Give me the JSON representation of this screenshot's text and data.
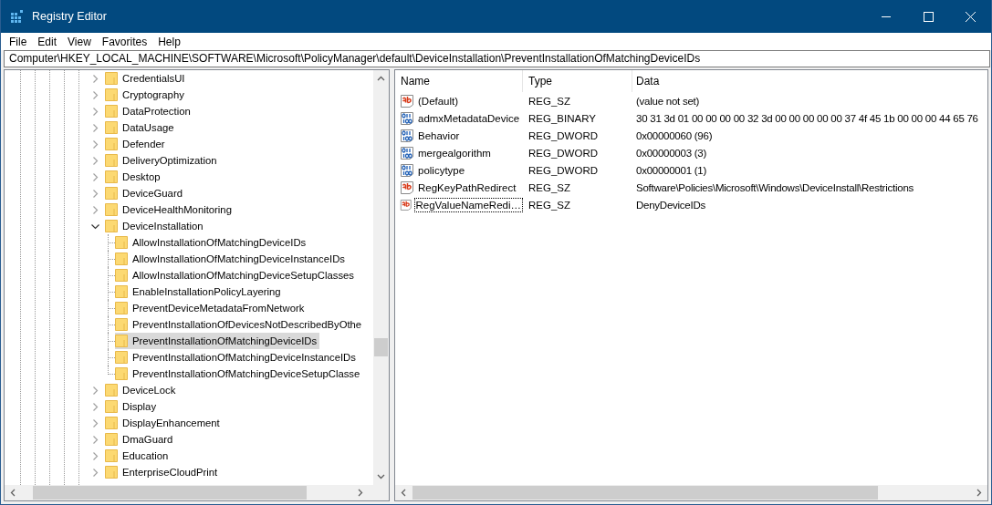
{
  "window": {
    "title": "Registry Editor"
  },
  "menu": [
    "File",
    "Edit",
    "View",
    "Favorites",
    "Help"
  ],
  "address": "Computer\\HKEY_LOCAL_MACHINE\\SOFTWARE\\Microsoft\\PolicyManager\\default\\DeviceInstallation\\PreventInstallationOfMatchingDeviceIDs",
  "tree": [
    {
      "label": "CredentialsUI",
      "expanded": false,
      "selected": false
    },
    {
      "label": "Cryptography",
      "expanded": false,
      "selected": false
    },
    {
      "label": "DataProtection",
      "expanded": false,
      "selected": false
    },
    {
      "label": "DataUsage",
      "expanded": false,
      "selected": false
    },
    {
      "label": "Defender",
      "expanded": false,
      "selected": false
    },
    {
      "label": "DeliveryOptimization",
      "expanded": false,
      "selected": false
    },
    {
      "label": "Desktop",
      "expanded": false,
      "selected": false
    },
    {
      "label": "DeviceGuard",
      "expanded": false,
      "selected": false
    },
    {
      "label": "DeviceHealthMonitoring",
      "expanded": false,
      "selected": false
    },
    {
      "label": "DeviceInstallation",
      "expanded": true,
      "selected": false,
      "children": [
        {
          "label": "AllowInstallationOfMatchingDeviceIDs",
          "selected": false
        },
        {
          "label": "AllowInstallationOfMatchingDeviceInstanceIDs",
          "selected": false
        },
        {
          "label": "AllowInstallationOfMatchingDeviceSetupClasses",
          "selected": false
        },
        {
          "label": "EnableInstallationPolicyLayering",
          "selected": false
        },
        {
          "label": "PreventDeviceMetadataFromNetwork",
          "selected": false
        },
        {
          "label": "PreventInstallationOfDevicesNotDescribedByOthe",
          "selected": false
        },
        {
          "label": "PreventInstallationOfMatchingDeviceIDs",
          "selected": true
        },
        {
          "label": "PreventInstallationOfMatchingDeviceInstanceIDs",
          "selected": false
        },
        {
          "label": "PreventInstallationOfMatchingDeviceSetupClasse",
          "selected": false
        }
      ]
    },
    {
      "label": "DeviceLock",
      "expanded": false,
      "selected": false
    },
    {
      "label": "Display",
      "expanded": false,
      "selected": false
    },
    {
      "label": "DisplayEnhancement",
      "expanded": false,
      "selected": false
    },
    {
      "label": "DmaGuard",
      "expanded": false,
      "selected": false
    },
    {
      "label": "Education",
      "expanded": false,
      "selected": false
    },
    {
      "label": "EnterpriseCloudPrint",
      "expanded": false,
      "selected": false
    }
  ],
  "values": {
    "columns": [
      "Name",
      "Type",
      "Data"
    ],
    "rows": [
      {
        "kind": "string",
        "name": "(Default)",
        "type": "REG_SZ",
        "data": "(value not set)",
        "focused": false
      },
      {
        "kind": "binary",
        "name": "admxMetadataDevice",
        "type": "REG_BINARY",
        "data": "30 31 3d 01 00 00 00 00 32 3d 00 00 00 00 00 37 4f 45 1b 00 00 00 44 65 76",
        "focused": false
      },
      {
        "kind": "binary",
        "name": "Behavior",
        "type": "REG_DWORD",
        "data": "0x00000060 (96)",
        "focused": false
      },
      {
        "kind": "binary",
        "name": "mergealgorithm",
        "type": "REG_DWORD",
        "data": "0x00000003 (3)",
        "focused": false
      },
      {
        "kind": "binary",
        "name": "policytype",
        "type": "REG_DWORD",
        "data": "0x00000001 (1)",
        "focused": false
      },
      {
        "kind": "string",
        "name": "RegKeyPathRedirect",
        "type": "REG_SZ",
        "data": "Software\\Policies\\Microsoft\\Windows\\DeviceInstall\\Restrictions",
        "focused": false
      },
      {
        "kind": "string",
        "name": "RegValueNameRedi…",
        "type": "REG_SZ",
        "data": "DenyDeviceIDs",
        "focused": true
      }
    ]
  }
}
